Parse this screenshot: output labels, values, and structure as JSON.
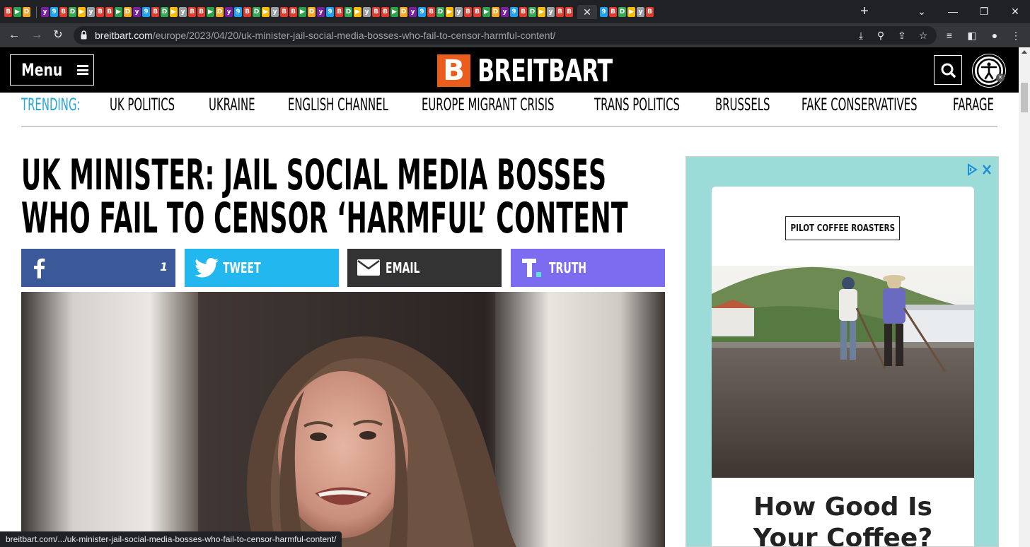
{
  "browser": {
    "url_host": "breitbart.com",
    "url_path": "/europe/2023/04/20/uk-minister-jail-social-media-bosses-who-fail-to-censor-harmful-content/",
    "status_url": "breitbart.com/.../uk-minister-jail-social-media-bosses-who-fail-to-censor-harmful-content/",
    "new_tab_label": "+",
    "close_tab_glyph": "✕"
  },
  "site": {
    "menu_label": "Menu",
    "logo_mark": "B",
    "logo_text": "BREITBART"
  },
  "trending": {
    "label": "TRENDING:",
    "items": [
      "UK POLITICS",
      "UKRAINE",
      "ENGLISH CHANNEL",
      "EUROPE MIGRANT CRISIS",
      "TRANS POLITICS",
      "BRUSSELS",
      "FAKE CONSERVATIVES",
      "FARAGE"
    ]
  },
  "article": {
    "headline_line1": "UK MINISTER: JAIL SOCIAL MEDIA BOSSES",
    "headline_line2": "WHO FAIL TO CENSOR ‘HARMFUL’ CONTENT"
  },
  "share": {
    "facebook_count": "1",
    "tweet_label": "TWEET",
    "email_label": "EMAIL",
    "truth_label": "TRUTH"
  },
  "ad": {
    "brand": "PILOT COFFEE ROASTERS",
    "headline_line1": "How Good Is",
    "headline_line2": "Your Coffee?"
  },
  "colors": {
    "brand_orange": "#ea5d1c",
    "trending_blue": "#27a6de",
    "facebook": "#3b5998",
    "twitter": "#23b7f0",
    "email": "#333333",
    "truth": "#7b6cf0",
    "ad_background": "#9bdcd9"
  }
}
